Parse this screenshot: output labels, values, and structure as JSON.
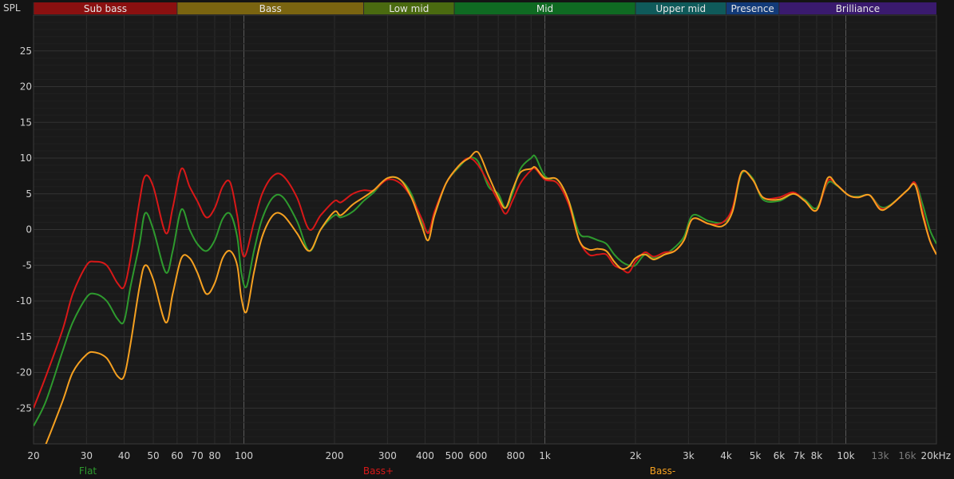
{
  "chart_data": {
    "type": "line",
    "ylabel": "SPL",
    "xscale": "log",
    "xlim": [
      20,
      20000
    ],
    "ylim": [
      -30,
      30
    ],
    "grid": true,
    "x_ticks": [
      {
        "v": 20,
        "label": "20"
      },
      {
        "v": 30,
        "label": "30"
      },
      {
        "v": 40,
        "label": "40"
      },
      {
        "v": 50,
        "label": "50"
      },
      {
        "v": 60,
        "label": "60"
      },
      {
        "v": 70,
        "label": "70"
      },
      {
        "v": 80,
        "label": "80"
      },
      {
        "v": 100,
        "label": "100"
      },
      {
        "v": 200,
        "label": "200"
      },
      {
        "v": 300,
        "label": "300"
      },
      {
        "v": 400,
        "label": "400"
      },
      {
        "v": 500,
        "label": "500"
      },
      {
        "v": 600,
        "label": "600"
      },
      {
        "v": 800,
        "label": "800"
      },
      {
        "v": 1000,
        "label": "1k"
      },
      {
        "v": 2000,
        "label": "2k"
      },
      {
        "v": 3000,
        "label": "3k"
      },
      {
        "v": 4000,
        "label": "4k"
      },
      {
        "v": 5000,
        "label": "5k"
      },
      {
        "v": 6000,
        "label": "6k"
      },
      {
        "v": 7000,
        "label": "7k"
      },
      {
        "v": 8000,
        "label": "8k"
      },
      {
        "v": 10000,
        "label": "10k"
      },
      {
        "v": 13000,
        "label": "13k",
        "dim": true
      },
      {
        "v": 16000,
        "label": "16k",
        "dim": true
      },
      {
        "v": 20000,
        "label": "20kHz"
      }
    ],
    "y_ticks": [
      -25,
      -20,
      -15,
      -10,
      -5,
      0,
      5,
      10,
      15,
      20,
      25
    ],
    "bands": [
      {
        "name": "Sub bass",
        "from": 20,
        "to": 60,
        "color": "#8a1010"
      },
      {
        "name": "Bass",
        "from": 60,
        "to": 250,
        "color": "#7a6410"
      },
      {
        "name": "Low mid",
        "from": 250,
        "to": 500,
        "color": "#4a6a10"
      },
      {
        "name": "Mid",
        "from": 500,
        "to": 2000,
        "color": "#0f6a22"
      },
      {
        "name": "Upper mid",
        "from": 2000,
        "to": 4000,
        "color": "#0f5a5a"
      },
      {
        "name": "Presence",
        "from": 4000,
        "to": 6000,
        "color": "#123a78"
      },
      {
        "name": "Brilliance",
        "from": 6000,
        "to": 20000,
        "color": "#3a1a6e"
      }
    ],
    "series": [
      {
        "name": "Flat",
        "color": "#2e9a2e",
        "legend_x": 110,
        "points": [
          [
            20,
            -27.5
          ],
          [
            22,
            -24
          ],
          [
            25,
            -17
          ],
          [
            27,
            -13
          ],
          [
            30,
            -9.5
          ],
          [
            32,
            -9
          ],
          [
            35,
            -10
          ],
          [
            38,
            -12.5
          ],
          [
            40,
            -12.8
          ],
          [
            42,
            -8
          ],
          [
            45,
            -2
          ],
          [
            47,
            2.3
          ],
          [
            50,
            0
          ],
          [
            55,
            -6
          ],
          [
            58,
            -3
          ],
          [
            62,
            2.8
          ],
          [
            66,
            0
          ],
          [
            70,
            -2
          ],
          [
            75,
            -3
          ],
          [
            80,
            -1.5
          ],
          [
            85,
            1.5
          ],
          [
            90,
            2.2
          ],
          [
            95,
            -1
          ],
          [
            98,
            -6
          ],
          [
            102,
            -8
          ],
          [
            108,
            -3
          ],
          [
            115,
            1.5
          ],
          [
            125,
            4.5
          ],
          [
            135,
            4.5
          ],
          [
            150,
            1.2
          ],
          [
            165,
            -3
          ],
          [
            180,
            0
          ],
          [
            200,
            2
          ],
          [
            210,
            1.7
          ],
          [
            230,
            2.5
          ],
          [
            250,
            4
          ],
          [
            270,
            5.2
          ],
          [
            300,
            7.2
          ],
          [
            330,
            7
          ],
          [
            360,
            5
          ],
          [
            390,
            1
          ],
          [
            410,
            -0.3
          ],
          [
            430,
            2
          ],
          [
            470,
            6.5
          ],
          [
            520,
            8.8
          ],
          [
            560,
            10
          ],
          [
            600,
            9.5
          ],
          [
            650,
            6
          ],
          [
            700,
            5
          ],
          [
            740,
            3
          ],
          [
            780,
            5
          ],
          [
            830,
            8.5
          ],
          [
            900,
            10
          ],
          [
            930,
            10.2
          ],
          [
            1000,
            7.5
          ],
          [
            1100,
            6.5
          ],
          [
            1200,
            4
          ],
          [
            1300,
            -0.5
          ],
          [
            1400,
            -1
          ],
          [
            1500,
            -1.5
          ],
          [
            1600,
            -2
          ],
          [
            1700,
            -3.5
          ],
          [
            1800,
            -4.5
          ],
          [
            1900,
            -5
          ],
          [
            2000,
            -5
          ],
          [
            2150,
            -3.5
          ],
          [
            2300,
            -4
          ],
          [
            2500,
            -3.5
          ],
          [
            2700,
            -2.5
          ],
          [
            2900,
            -1
          ],
          [
            3100,
            2
          ],
          [
            3500,
            1.2
          ],
          [
            3900,
            1
          ],
          [
            4200,
            2.5
          ],
          [
            4500,
            7.8
          ],
          [
            4900,
            7.2
          ],
          [
            5300,
            4.2
          ],
          [
            6000,
            4
          ],
          [
            6700,
            5
          ],
          [
            7300,
            4.2
          ],
          [
            8000,
            3
          ],
          [
            8700,
            6.5
          ],
          [
            9300,
            6.2
          ],
          [
            10200,
            4.8
          ],
          [
            11000,
            4.6
          ],
          [
            12000,
            4.8
          ],
          [
            13000,
            3.2
          ],
          [
            14000,
            3.4
          ],
          [
            16000,
            5.5
          ],
          [
            17000,
            6.5
          ],
          [
            18000,
            3.5
          ],
          [
            19000,
            0
          ],
          [
            20000,
            -2
          ]
        ]
      },
      {
        "name": "Bass+",
        "color": "#d81818",
        "legend_x": 474,
        "points": [
          [
            20,
            -25
          ],
          [
            22,
            -20.5
          ],
          [
            25,
            -14
          ],
          [
            27,
            -9
          ],
          [
            30,
            -5
          ],
          [
            32,
            -4.5
          ],
          [
            35,
            -5
          ],
          [
            38,
            -7.5
          ],
          [
            40,
            -8
          ],
          [
            42,
            -4
          ],
          [
            45,
            4
          ],
          [
            47,
            7.5
          ],
          [
            50,
            6
          ],
          [
            55,
            -0.5
          ],
          [
            58,
            3
          ],
          [
            62,
            8.5
          ],
          [
            66,
            6
          ],
          [
            70,
            4
          ],
          [
            75,
            1.7
          ],
          [
            80,
            3
          ],
          [
            85,
            6
          ],
          [
            90,
            6.6
          ],
          [
            95,
            2
          ],
          [
            100,
            -3.8
          ],
          [
            108,
            1
          ],
          [
            115,
            5
          ],
          [
            125,
            7.5
          ],
          [
            135,
            7.5
          ],
          [
            150,
            4.5
          ],
          [
            165,
            0
          ],
          [
            180,
            2
          ],
          [
            200,
            4
          ],
          [
            210,
            3.8
          ],
          [
            230,
            5
          ],
          [
            250,
            5.5
          ],
          [
            270,
            5.5
          ],
          [
            300,
            7
          ],
          [
            330,
            6.5
          ],
          [
            360,
            4.5
          ],
          [
            390,
            1.5
          ],
          [
            410,
            -0.5
          ],
          [
            430,
            2.5
          ],
          [
            470,
            6.5
          ],
          [
            520,
            9
          ],
          [
            560,
            10
          ],
          [
            600,
            9
          ],
          [
            650,
            6.5
          ],
          [
            700,
            4
          ],
          [
            740,
            2.2
          ],
          [
            780,
            4
          ],
          [
            830,
            6.5
          ],
          [
            900,
            8.3
          ],
          [
            930,
            8.5
          ],
          [
            1000,
            7
          ],
          [
            1100,
            6.5
          ],
          [
            1200,
            3.5
          ],
          [
            1300,
            -1.5
          ],
          [
            1400,
            -3.5
          ],
          [
            1500,
            -3.5
          ],
          [
            1600,
            -3.5
          ],
          [
            1700,
            -5
          ],
          [
            1800,
            -5.5
          ],
          [
            1900,
            -6
          ],
          [
            2000,
            -4.5
          ],
          [
            2150,
            -3.2
          ],
          [
            2300,
            -3.8
          ],
          [
            2500,
            -3.2
          ],
          [
            2700,
            -3
          ],
          [
            2900,
            -1.5
          ],
          [
            3100,
            1.5
          ],
          [
            3500,
            0.8
          ],
          [
            3900,
            1
          ],
          [
            4200,
            3
          ],
          [
            4500,
            8
          ],
          [
            4900,
            7
          ],
          [
            5300,
            4.5
          ],
          [
            6000,
            4.5
          ],
          [
            6700,
            5.2
          ],
          [
            7300,
            4
          ],
          [
            8000,
            2.7
          ],
          [
            8700,
            6.8
          ],
          [
            9300,
            6.3
          ],
          [
            10200,
            4.8
          ],
          [
            11000,
            4.5
          ],
          [
            12000,
            4.8
          ],
          [
            13000,
            3
          ],
          [
            14000,
            3.3
          ],
          [
            16000,
            5.5
          ],
          [
            17000,
            6.5
          ],
          [
            18000,
            2.5
          ],
          [
            19000,
            -1.5
          ],
          [
            20000,
            -3.5
          ]
        ]
      },
      {
        "name": "Bass-",
        "color": "#f5a020",
        "legend_x": 830,
        "points": [
          [
            20,
            -34
          ],
          [
            22,
            -30
          ],
          [
            25,
            -24
          ],
          [
            27,
            -20
          ],
          [
            30,
            -17.5
          ],
          [
            32,
            -17.2
          ],
          [
            35,
            -18
          ],
          [
            38,
            -20.5
          ],
          [
            40,
            -20.5
          ],
          [
            42,
            -16
          ],
          [
            45,
            -8
          ],
          [
            47,
            -5
          ],
          [
            50,
            -7
          ],
          [
            55,
            -13
          ],
          [
            58,
            -9
          ],
          [
            62,
            -4
          ],
          [
            66,
            -4
          ],
          [
            70,
            -6
          ],
          [
            75,
            -9
          ],
          [
            80,
            -7.5
          ],
          [
            85,
            -4
          ],
          [
            90,
            -3
          ],
          [
            95,
            -5
          ],
          [
            98,
            -9.5
          ],
          [
            102,
            -11.5
          ],
          [
            108,
            -6
          ],
          [
            115,
            -1
          ],
          [
            125,
            2
          ],
          [
            135,
            2
          ],
          [
            150,
            -0.5
          ],
          [
            165,
            -3
          ],
          [
            180,
            0
          ],
          [
            200,
            2.5
          ],
          [
            210,
            2
          ],
          [
            230,
            3.5
          ],
          [
            250,
            4.5
          ],
          [
            270,
            5.5
          ],
          [
            300,
            7.2
          ],
          [
            330,
            7
          ],
          [
            360,
            4.5
          ],
          [
            390,
            0.5
          ],
          [
            410,
            -1.5
          ],
          [
            430,
            2
          ],
          [
            470,
            6.5
          ],
          [
            520,
            9
          ],
          [
            560,
            10
          ],
          [
            600,
            10.8
          ],
          [
            650,
            7.5
          ],
          [
            700,
            4.5
          ],
          [
            740,
            3
          ],
          [
            780,
            5.5
          ],
          [
            830,
            8
          ],
          [
            900,
            8.5
          ],
          [
            930,
            8.7
          ],
          [
            1000,
            7.2
          ],
          [
            1100,
            7
          ],
          [
            1200,
            4
          ],
          [
            1300,
            -1.5
          ],
          [
            1400,
            -2.8
          ],
          [
            1500,
            -2.7
          ],
          [
            1600,
            -3
          ],
          [
            1700,
            -4.5
          ],
          [
            1800,
            -5.5
          ],
          [
            1900,
            -5.2
          ],
          [
            2000,
            -4
          ],
          [
            2150,
            -3.5
          ],
          [
            2300,
            -4.2
          ],
          [
            2500,
            -3.5
          ],
          [
            2700,
            -3
          ],
          [
            2900,
            -1.5
          ],
          [
            3100,
            1.5
          ],
          [
            3500,
            0.8
          ],
          [
            3900,
            0.5
          ],
          [
            4200,
            2.5
          ],
          [
            4500,
            8
          ],
          [
            4900,
            7
          ],
          [
            5300,
            4.5
          ],
          [
            6000,
            4.2
          ],
          [
            6700,
            5
          ],
          [
            7300,
            4
          ],
          [
            8000,
            2.7
          ],
          [
            8700,
            7.2
          ],
          [
            9300,
            6.3
          ],
          [
            10200,
            4.8
          ],
          [
            11000,
            4.5
          ],
          [
            12000,
            4.8
          ],
          [
            13000,
            2.8
          ],
          [
            14000,
            3.3
          ],
          [
            16000,
            5.5
          ],
          [
            17000,
            6.2
          ],
          [
            18000,
            2
          ],
          [
            19000,
            -1.5
          ],
          [
            20000,
            -3.5
          ]
        ]
      }
    ]
  }
}
